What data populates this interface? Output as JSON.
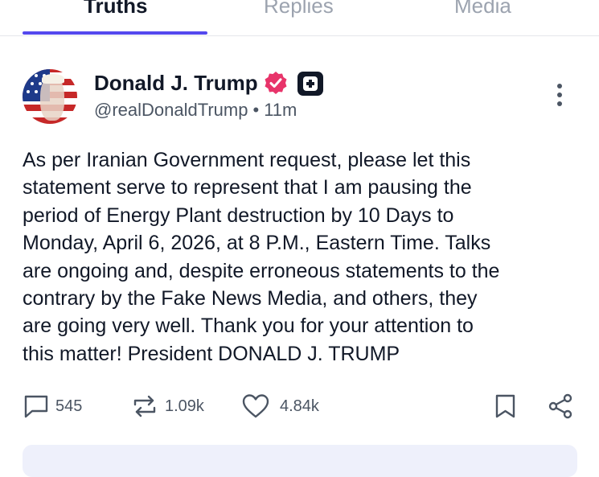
{
  "tabs": [
    {
      "label": "Truths",
      "active": true
    },
    {
      "label": "Replies",
      "active": false
    },
    {
      "label": "Media",
      "active": false
    }
  ],
  "accent_color": "#5448ee",
  "verified_color": "#e8346a",
  "post": {
    "author_name": "Donald J. Trump",
    "handle": "@realDonaldTrump",
    "separator": "•",
    "time": "11m",
    "body_lines": [
      "As per Iranian Government request, please let this",
      "statement serve to represent that I am pausing the",
      "period of Energy Plant destruction by 10 Days to",
      "Monday, April 6, 2026, at 8 P.M., Eastern Time. Talks",
      "are ongoing and, despite erroneous statements to the",
      "contrary by the Fake News Media, and others, they",
      "are going very well. Thank you for your attention to",
      "this matter! President DONALD J. TRUMP"
    ],
    "replies": "545",
    "retruths": "1.09k",
    "likes": "4.84k"
  },
  "icons": [
    "verified-badge-icon",
    "truth-plus-icon",
    "more-options-icon",
    "reply-icon",
    "retruth-icon",
    "heart-icon",
    "bookmark-icon",
    "share-icon"
  ]
}
